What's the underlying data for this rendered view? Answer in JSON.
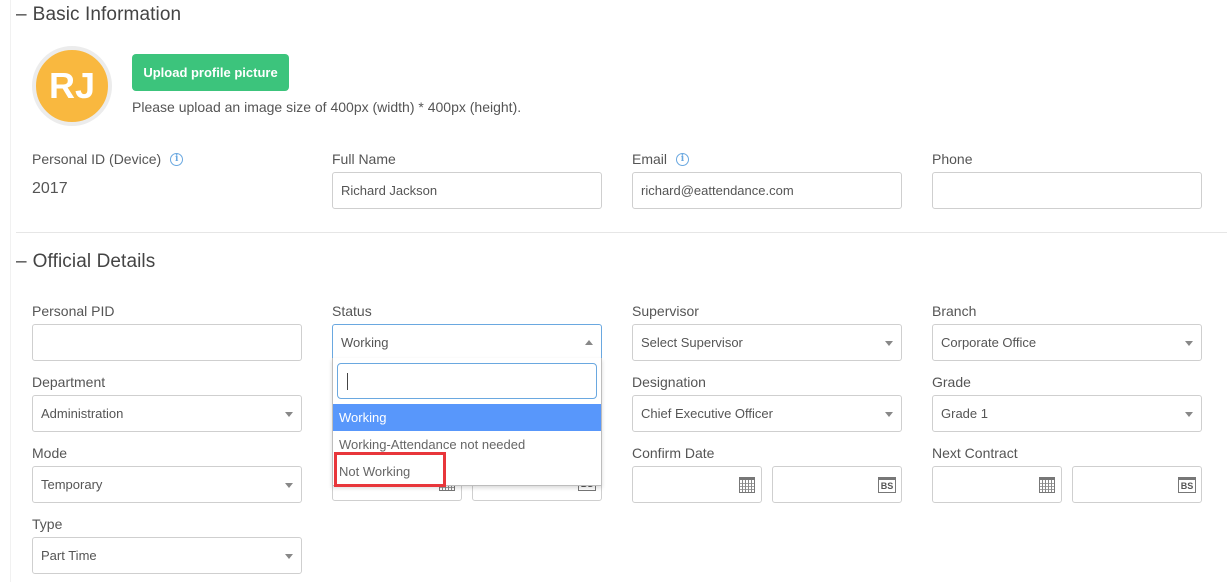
{
  "basic_information": {
    "section_title": "Basic Information",
    "toggle_symbol": "–",
    "avatar_initials": "RJ",
    "upload_button_label": "Upload profile picture",
    "upload_hint": "Please upload an image size of 400px (width) * 400px (height).",
    "fields": {
      "personal_id": {
        "label": "Personal ID (Device)",
        "value": "2017",
        "info_icon": "i"
      },
      "full_name": {
        "label": "Full Name",
        "value": "Richard Jackson"
      },
      "email": {
        "label": "Email",
        "value": "richard@eattendance.com",
        "info_icon": "i"
      },
      "phone": {
        "label": "Phone",
        "value": ""
      }
    }
  },
  "official_details": {
    "section_title": "Official Details",
    "toggle_symbol": "–",
    "fields": {
      "personal_pid": {
        "label": "Personal PID",
        "value": ""
      },
      "status": {
        "label": "Status",
        "value": "Working",
        "search_value": "",
        "options": [
          "Working",
          "Working-Attendance not needed",
          "Not Working"
        ],
        "selected_option": "Working",
        "highlighted_option": "Not Working"
      },
      "supervisor": {
        "label": "Supervisor",
        "value": "Select Supervisor"
      },
      "branch": {
        "label": "Branch",
        "value": "Corporate Office"
      },
      "department": {
        "label": "Department",
        "value": "Administration"
      },
      "designation": {
        "label": "Designation",
        "value": "Chief Executive Officer"
      },
      "grade": {
        "label": "Grade",
        "value": "Grade 1"
      },
      "mode": {
        "label": "Mode",
        "value": "Temporary"
      },
      "confirm_date": {
        "label": "Confirm Date",
        "ad_value": "",
        "bs_value": "",
        "bs_icon_text": "BS"
      },
      "next_contract": {
        "label": "Next Contract",
        "ad_value": "",
        "bs_value": "",
        "bs_icon_text": "BS"
      },
      "type": {
        "label": "Type",
        "value": "Part Time"
      }
    }
  },
  "colors": {
    "avatar_bg": "#f9b83f",
    "upload_button_bg": "#3cc47c",
    "selected_option_bg": "#5897fb",
    "highlight_border": "#e8363b",
    "info_icon": "#6aa8e0"
  }
}
